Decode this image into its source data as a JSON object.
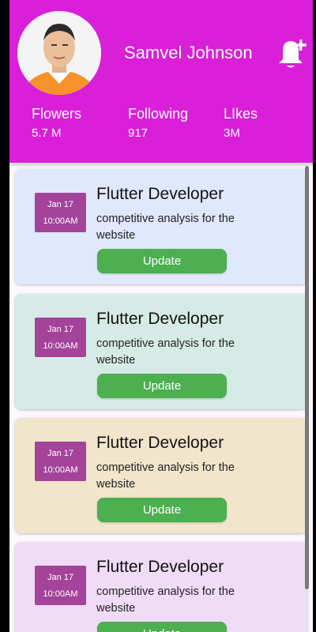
{
  "profile": {
    "name": "Samvel Johnson",
    "stats": [
      {
        "label": "Flowers",
        "value": "5.7 M"
      },
      {
        "label": "Following",
        "value": "917"
      },
      {
        "label": "LIkes",
        "value": "3M"
      }
    ]
  },
  "cards": [
    {
      "date": "Jan 17",
      "time": "10:00AM",
      "title": "Flutter Developer",
      "description": "competitive analysis for the website",
      "button": "Update",
      "color": "#e0e8fd"
    },
    {
      "date": "Jan 17",
      "time": "10:00AM",
      "title": "Flutter Developer",
      "description": "competitive analysis for the website",
      "button": "Update",
      "color": "#d6ebe5"
    },
    {
      "date": "Jan 17",
      "time": "10:00AM",
      "title": "Flutter Developer",
      "description": "competitive analysis for the website",
      "button": "Update",
      "color": "#f1e5cc"
    },
    {
      "date": "Jan 17",
      "time": "10:00AM",
      "title": "Flutter Developer",
      "description": "competitive analysis for the website",
      "button": "Update",
      "color": "#f0dcf7"
    }
  ],
  "colors": {
    "header": "#d91fd8",
    "date_box": "#a4439a",
    "button": "#4caf50"
  },
  "icons": {
    "bell": "add-notification-icon",
    "avatar": "profile-photo"
  }
}
